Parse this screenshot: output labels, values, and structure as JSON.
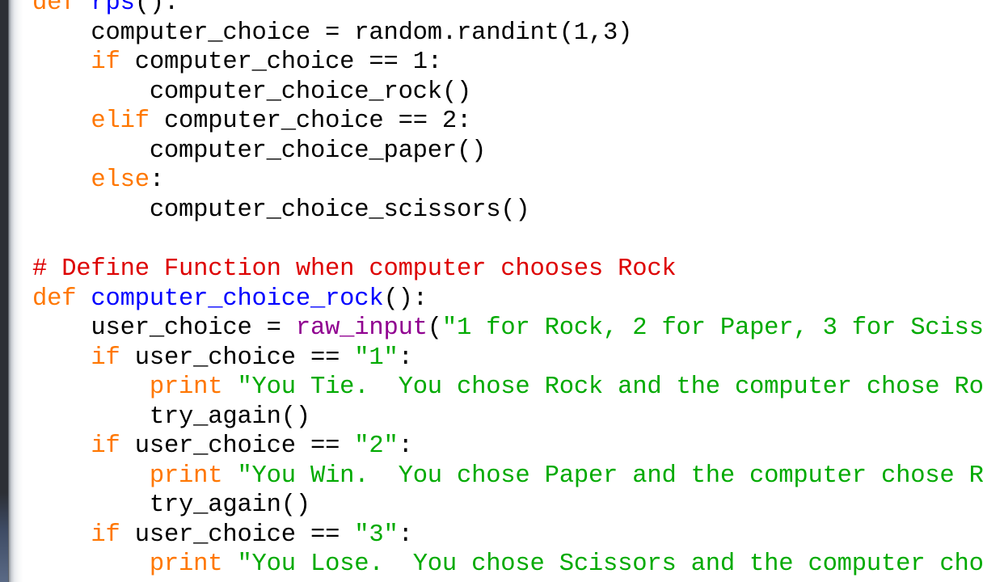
{
  "editor": {
    "lines": [
      {
        "seg": [
          [
            "kw",
            "def"
          ],
          [
            "plain",
            " "
          ],
          [
            "def-name",
            "rps"
          ],
          [
            "plain",
            "():"
          ]
        ]
      },
      {
        "seg": [
          [
            "plain",
            "    computer_choice = random.randint(1,3)"
          ]
        ]
      },
      {
        "seg": [
          [
            "plain",
            "    "
          ],
          [
            "kw",
            "if"
          ],
          [
            "plain",
            " computer_choice == 1:"
          ]
        ]
      },
      {
        "seg": [
          [
            "plain",
            "        computer_choice_rock()"
          ]
        ]
      },
      {
        "seg": [
          [
            "plain",
            "    "
          ],
          [
            "kw",
            "elif"
          ],
          [
            "plain",
            " computer_choice == 2:"
          ]
        ]
      },
      {
        "seg": [
          [
            "plain",
            "        computer_choice_paper()"
          ]
        ]
      },
      {
        "seg": [
          [
            "plain",
            "    "
          ],
          [
            "kw",
            "else"
          ],
          [
            "plain",
            ":"
          ]
        ]
      },
      {
        "seg": [
          [
            "plain",
            "        computer_choice_scissors()"
          ]
        ]
      },
      {
        "seg": [
          [
            "plain",
            ""
          ]
        ]
      },
      {
        "seg": [
          [
            "cmt",
            "# Define Function when computer chooses Rock"
          ]
        ]
      },
      {
        "seg": [
          [
            "kw",
            "def"
          ],
          [
            "plain",
            " "
          ],
          [
            "def-name",
            "computer_choice_rock"
          ],
          [
            "plain",
            "():"
          ]
        ]
      },
      {
        "seg": [
          [
            "plain",
            "    user_choice = "
          ],
          [
            "builtin",
            "raw_input"
          ],
          [
            "plain",
            "("
          ],
          [
            "str",
            "\"1 for Rock, 2 for Paper, 3 for Sciss"
          ]
        ]
      },
      {
        "seg": [
          [
            "plain",
            "    "
          ],
          [
            "kw",
            "if"
          ],
          [
            "plain",
            " user_choice == "
          ],
          [
            "str",
            "\"1\""
          ],
          [
            "plain",
            ":"
          ]
        ]
      },
      {
        "seg": [
          [
            "plain",
            "        "
          ],
          [
            "kw",
            "print"
          ],
          [
            "plain",
            " "
          ],
          [
            "str",
            "\"You Tie.  You chose Rock and the computer chose Ro"
          ]
        ]
      },
      {
        "seg": [
          [
            "plain",
            "        try_again()"
          ]
        ]
      },
      {
        "seg": [
          [
            "plain",
            "    "
          ],
          [
            "kw",
            "if"
          ],
          [
            "plain",
            " user_choice == "
          ],
          [
            "str",
            "\"2\""
          ],
          [
            "plain",
            ":"
          ]
        ]
      },
      {
        "seg": [
          [
            "plain",
            "        "
          ],
          [
            "kw",
            "print"
          ],
          [
            "plain",
            " "
          ],
          [
            "str",
            "\"You Win.  You chose Paper and the computer chose R"
          ]
        ]
      },
      {
        "seg": [
          [
            "plain",
            "        try_again()"
          ]
        ]
      },
      {
        "seg": [
          [
            "plain",
            "    "
          ],
          [
            "kw",
            "if"
          ],
          [
            "plain",
            " user_choice == "
          ],
          [
            "str",
            "\"3\""
          ],
          [
            "plain",
            ":"
          ]
        ]
      },
      {
        "seg": [
          [
            "plain",
            "        "
          ],
          [
            "kw",
            "print"
          ],
          [
            "plain",
            " "
          ],
          [
            "str",
            "\"You Lose.  You chose Scissors and the computer cho"
          ]
        ]
      }
    ]
  }
}
